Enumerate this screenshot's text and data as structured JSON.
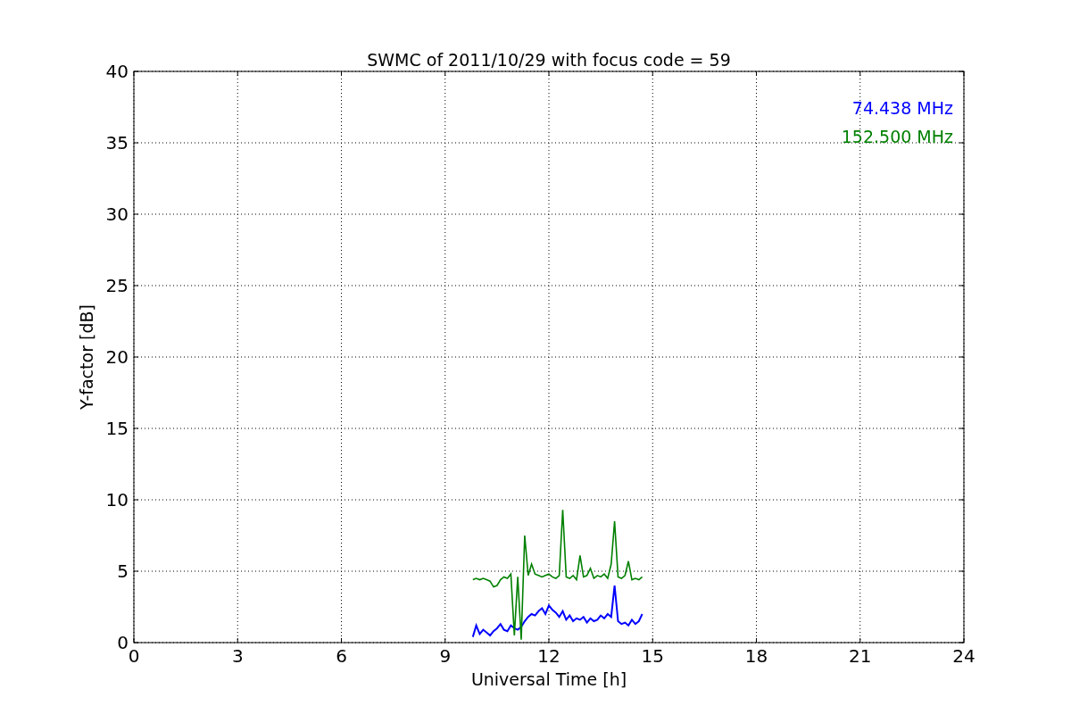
{
  "chart_data": {
    "type": "line",
    "title": "SWMC of 2011/10/29 with focus code = 59",
    "xlabel": "Universal Time [h]",
    "ylabel": "Y-factor [dB]",
    "x": [
      9.8,
      9.9,
      10.0,
      10.1,
      10.2,
      10.3,
      10.4,
      10.5,
      10.6,
      10.7,
      10.8,
      10.9,
      11.0,
      11.1,
      11.2,
      11.3,
      11.4,
      11.5,
      11.6,
      11.7,
      11.8,
      11.9,
      12.0,
      12.1,
      12.2,
      12.3,
      12.4,
      12.5,
      12.6,
      12.7,
      12.8,
      12.9,
      13.0,
      13.1,
      13.2,
      13.3,
      13.4,
      13.5,
      13.6,
      13.7,
      13.8,
      13.9,
      14.0,
      14.1,
      14.2,
      14.3,
      14.4,
      14.5,
      14.6,
      14.7
    ],
    "series": [
      {
        "name": "74.438 MHz",
        "color": "#0000ff",
        "values": [
          0.4,
          1.2,
          0.6,
          0.9,
          0.7,
          0.5,
          0.8,
          1.0,
          1.3,
          0.9,
          0.8,
          1.2,
          1.0,
          0.9,
          1.1,
          1.5,
          1.8,
          2.0,
          1.9,
          2.2,
          2.4,
          2.0,
          2.6,
          2.3,
          2.1,
          1.8,
          2.2,
          1.6,
          1.9,
          1.5,
          1.7,
          1.6,
          1.8,
          1.4,
          1.7,
          1.5,
          1.6,
          1.9,
          1.7,
          2.0,
          1.8,
          4.0,
          1.5,
          1.3,
          1.4,
          1.2,
          1.6,
          1.3,
          1.5,
          2.0
        ]
      },
      {
        "name": "152.500 MHz",
        "color": "#008000",
        "values": [
          4.4,
          4.5,
          4.4,
          4.5,
          4.4,
          4.3,
          3.9,
          4.0,
          4.4,
          4.6,
          4.5,
          4.8,
          0.5,
          4.6,
          0.2,
          7.5,
          4.7,
          5.5,
          4.8,
          4.7,
          4.6,
          4.7,
          4.8,
          4.6,
          4.5,
          4.7,
          9.3,
          4.6,
          4.5,
          4.7,
          4.4,
          6.1,
          4.6,
          4.7,
          5.2,
          4.5,
          4.7,
          4.6,
          4.8,
          4.5,
          5.5,
          8.5,
          4.6,
          4.5,
          4.7,
          5.7,
          4.4,
          4.5,
          4.4,
          4.6
        ]
      }
    ],
    "xlim": [
      0,
      24
    ],
    "ylim": [
      0,
      40
    ],
    "xticks": [
      0,
      3,
      6,
      9,
      12,
      15,
      18,
      21,
      24
    ],
    "yticks": [
      0,
      5,
      10,
      15,
      20,
      25,
      30,
      35,
      40
    ],
    "grid": true
  }
}
